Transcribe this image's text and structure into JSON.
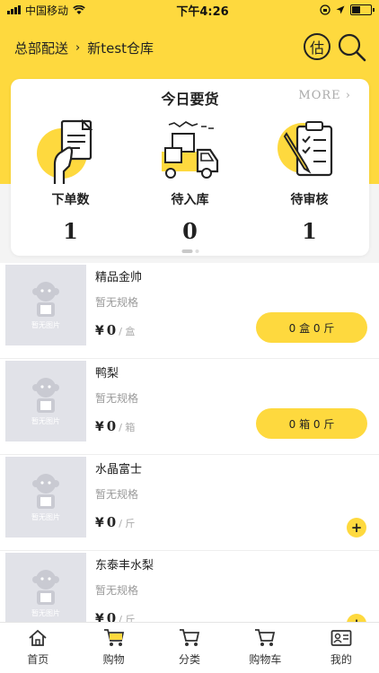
{
  "status_bar": {
    "carrier": "中国移动",
    "time": "下午4:26"
  },
  "header": {
    "org": "总部配送",
    "warehouse": "新test仓库",
    "estimate_icon_char": "估"
  },
  "summary": {
    "title": "今日要货",
    "more": "MORE",
    "stats": [
      {
        "label": "下单数",
        "value": "1",
        "icon": "document-hand-icon"
      },
      {
        "label": "待入库",
        "value": "0",
        "icon": "truck-icon"
      },
      {
        "label": "待审核",
        "value": "1",
        "icon": "clipboard-checklist-icon"
      }
    ]
  },
  "products": [
    {
      "name": "精品金帅",
      "spec": "暂无规格",
      "currency": "¥",
      "price": "0",
      "unit": "/ 盒",
      "qty_label": "0 盒 0 斤",
      "thumb_caption": "暂无图片"
    },
    {
      "name": "鸭梨",
      "spec": "暂无规格",
      "currency": "¥",
      "price": "0",
      "unit": "/ 箱",
      "qty_label": "0 箱 0 斤",
      "thumb_caption": "暂无图片"
    },
    {
      "name": "水晶富士",
      "spec": "暂无规格",
      "currency": "¥",
      "price": "0",
      "unit": "/ 斤",
      "add_label": "+",
      "thumb_caption": "暂无图片"
    },
    {
      "name": "东泰丰水梨",
      "spec": "暂无规格",
      "currency": "¥",
      "price": "0",
      "unit": "/ 斤",
      "add_label": "+",
      "thumb_caption": "暂无图片"
    }
  ],
  "tabs": [
    {
      "label": "首页",
      "icon": "home-icon"
    },
    {
      "label": "购物",
      "icon": "shopping-cart-icon"
    },
    {
      "label": "分类",
      "icon": "category-cart-icon"
    },
    {
      "label": "购物车",
      "icon": "cart-icon"
    },
    {
      "label": "我的",
      "icon": "profile-card-icon"
    }
  ],
  "colors": {
    "accent": "#fed93e",
    "placeholder": "#e1e2e8"
  }
}
